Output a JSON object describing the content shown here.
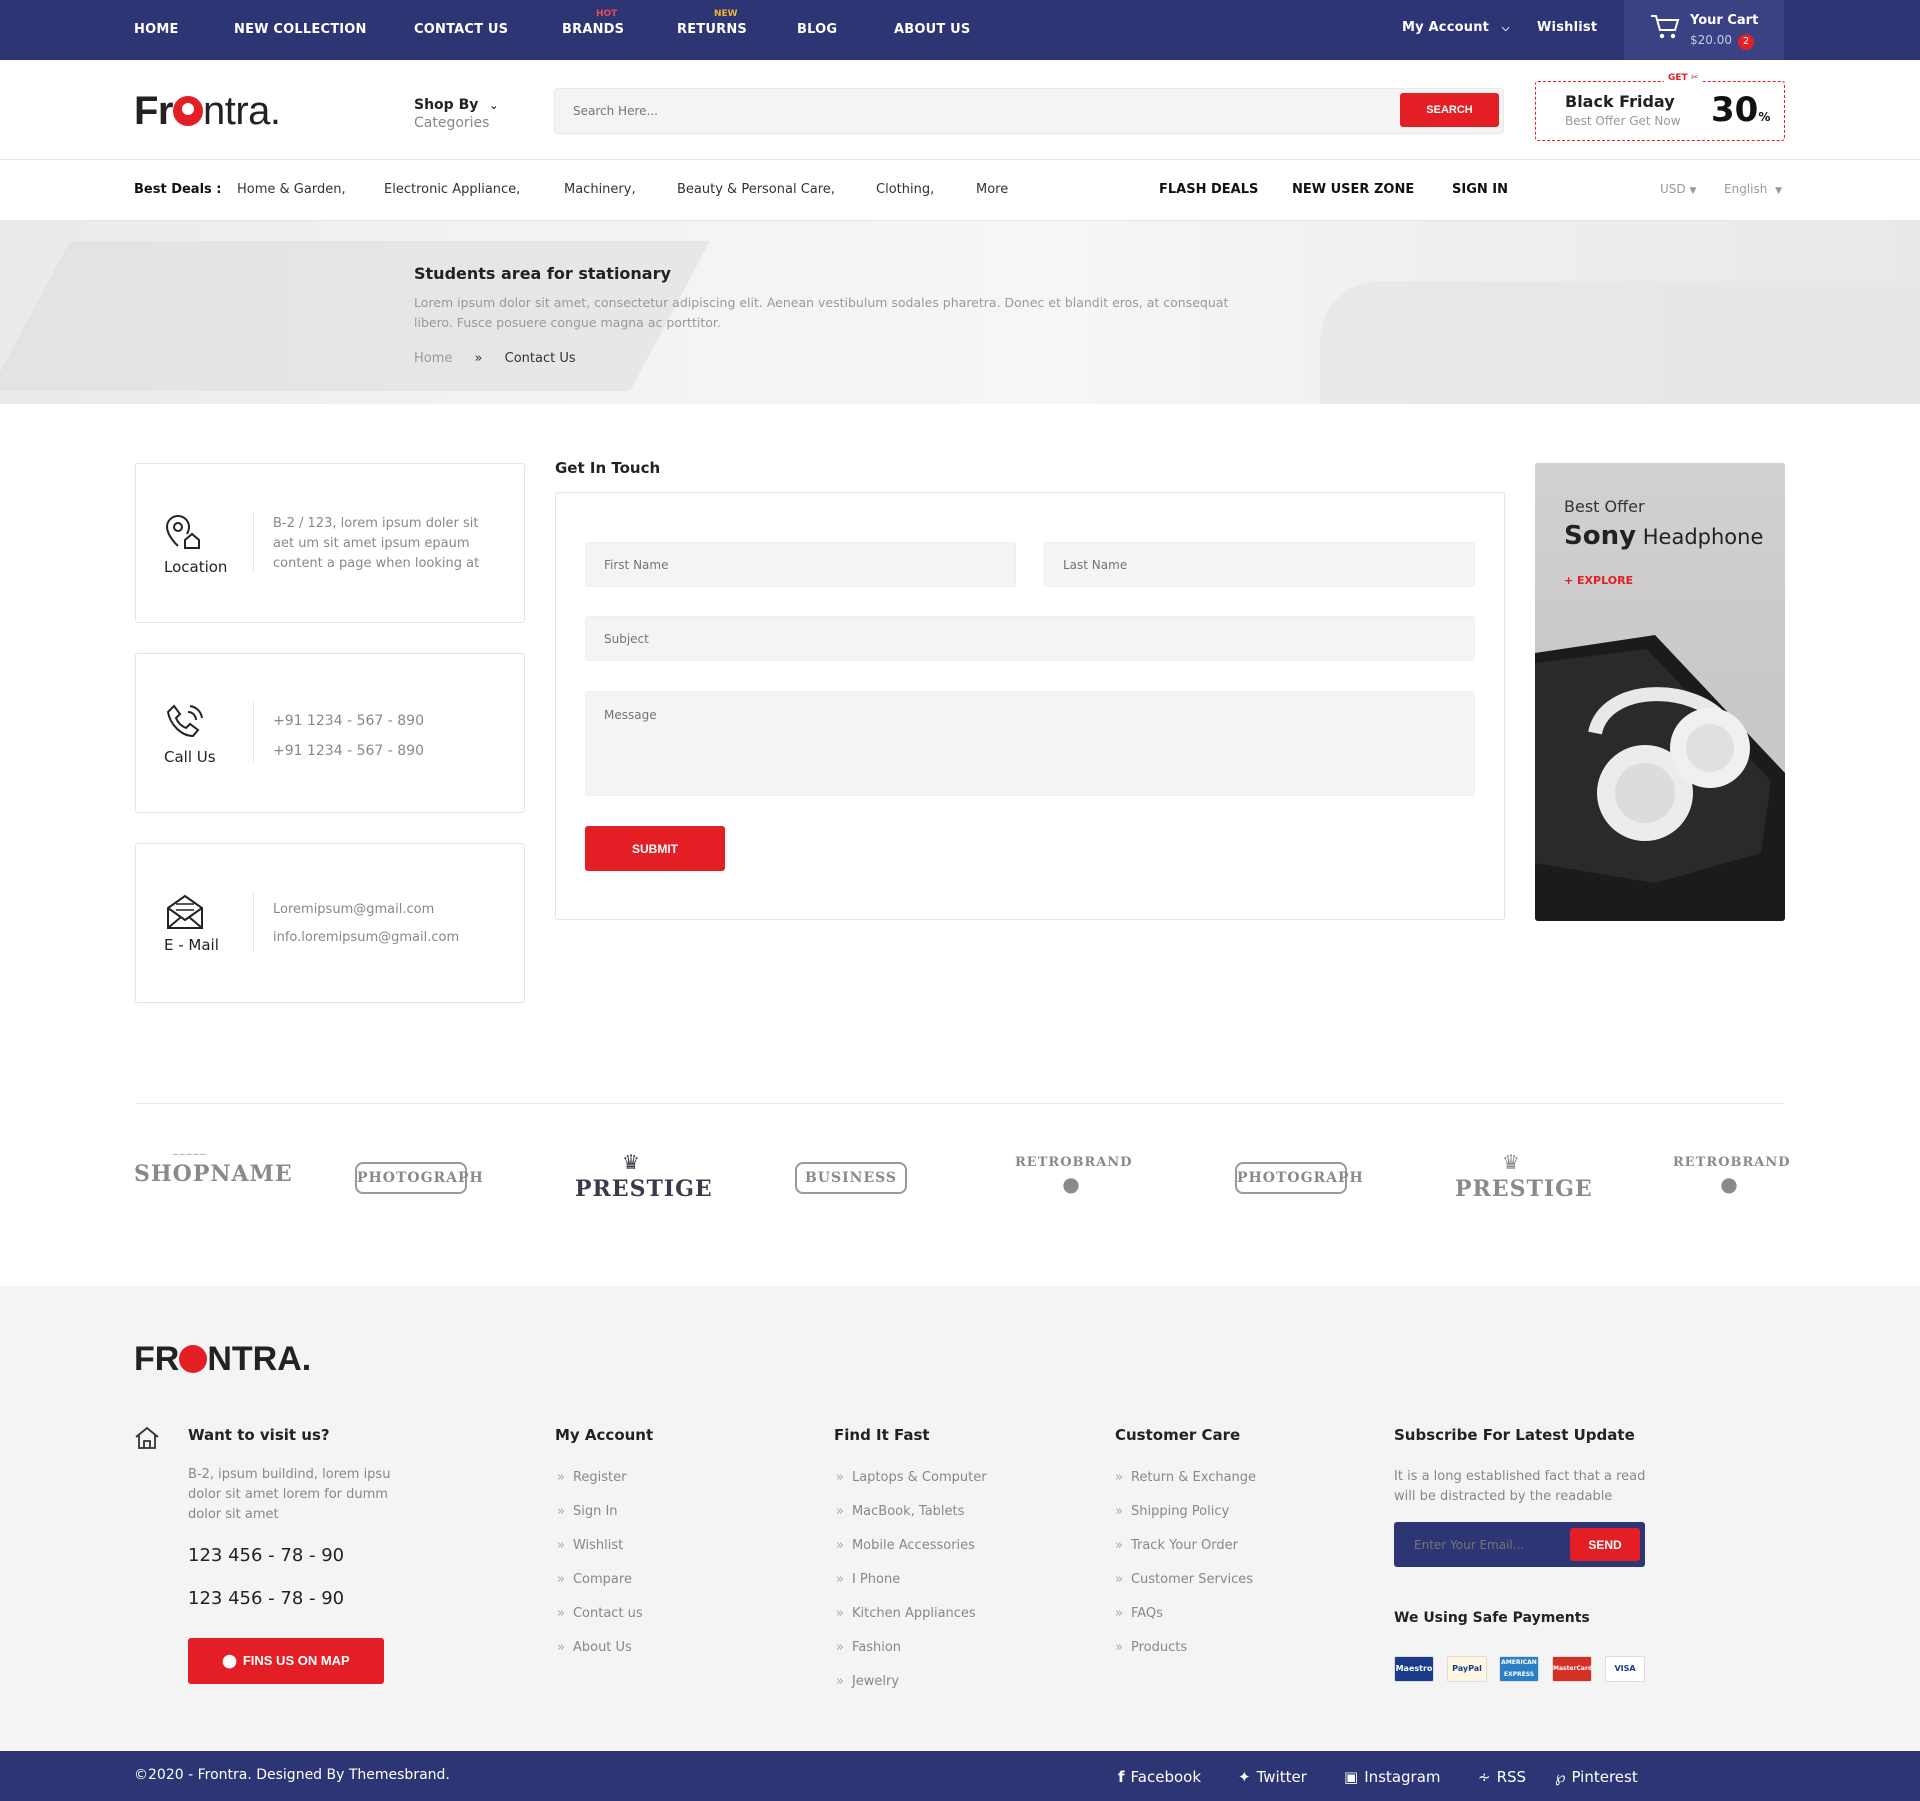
{
  "topnav": {
    "items": [
      "HOME",
      "NEW COLLECTION",
      "CONTACT US",
      "BRANDS",
      "RETURNS",
      "BLOG",
      "ABOUT US"
    ],
    "badge_hot": "HOT",
    "badge_new": "NEW",
    "my_account": "My Account",
    "wishlist": "Wishlist",
    "cart_label": "Your Cart",
    "cart_total": "$20.00",
    "cart_count": "2"
  },
  "header": {
    "logo_a": "Fr",
    "logo_b": "ntra.",
    "shop_by": "Shop By",
    "categories": "Categories",
    "search_placeholder": "Search Here...",
    "search_button": "SEARCH",
    "promo_get": "GET",
    "promo_title": "Black Friday",
    "promo_sub": "Best Offer Get Now",
    "promo_value": "30",
    "promo_unit": "%"
  },
  "deals": {
    "label": "Best Deals :",
    "items": [
      "Home & Garden,",
      "Electronic Appliance,",
      "Machinery,",
      "Beauty & Personal Care,",
      "Clothing,",
      "More"
    ],
    "links": [
      "FLASH DEALS",
      "NEW USER ZONE",
      "SIGN IN"
    ],
    "currency": "USD",
    "language": "English"
  },
  "hero": {
    "title": "Students area for stationary",
    "text": "Lorem ipsum dolor sit amet, consectetur adipiscing elit. Aenean vestibulum sodales pharetra. Donec et blandit eros, at consequat libero. Fusce posuere congue magna ac porttitor.",
    "breadcrumb_home": "Home",
    "breadcrumb_sep": "»",
    "breadcrumb_current": "Contact Us"
  },
  "contact": {
    "location_label": "Location",
    "location_text": "B-2 / 123, lorem ipsum doler sit aet um sit amet ipsum epaum content a page when looking at",
    "call_label": "Call Us",
    "phone1": "+91 1234 - 567 - 890",
    "phone2": "+91 1234 - 567 - 890",
    "mail_label": "E - Mail",
    "email1": "Loremipsum@gmail.com",
    "email2": "info.loremipsum@gmail.com"
  },
  "form": {
    "title": "Get In Touch",
    "first_name": "First Name",
    "last_name": "Last Name",
    "subject": "Subject",
    "message": "Message",
    "submit": "SUBMIT"
  },
  "offer": {
    "kicker": "Best Offer",
    "brand": "Sony",
    "product": "Headphone",
    "cta": "+ EXPLORE"
  },
  "brands": [
    "SHOPNAME",
    "PHOTOGRAPH",
    "PRESTIGE",
    "BUSINESS",
    "RETROBRAND",
    "PHOTOGRAPH",
    "PRESTIGE",
    "RETROBRAND"
  ],
  "footer": {
    "logo_a": "FR",
    "logo_b": "NTRA.",
    "visit_title": "Want to visit us?",
    "visit_text": "B-2, ipsum buildind, lorem ipsu dolor sit amet lorem for dumm dolor sit amet",
    "phone1": "123 456 - 78 - 90",
    "phone2": "123 456 - 78 - 90",
    "map_button": "FINS US ON MAP",
    "col_account_title": "My Account",
    "col_account": [
      "Register",
      "Sign In",
      "Wishlist",
      "Compare",
      "Contact us",
      "About Us"
    ],
    "col_find_title": "Find It Fast",
    "col_find": [
      "Laptops & Computer",
      "MacBook, Tablets",
      "Mobile Accessories",
      "I Phone",
      "Kitchen Appliances",
      "Fashion",
      "Jewelry"
    ],
    "col_care_title": "Customer Care",
    "col_care": [
      "Return & Exchange",
      "Shipping Policy",
      "Track Your Order",
      "Customer Services",
      "FAQs",
      "Products"
    ],
    "subscribe_title": "Subscribe For Latest Update",
    "subscribe_text": "It is a long established fact that a read will be distracted by the readable",
    "email_placeholder": "Enter Your Email...",
    "send": "SEND",
    "payments_title": "We Using Safe Payments",
    "payments": [
      "Maestro",
      "PayPal",
      "AMERICAN EXPRESS",
      "MasterCard",
      "VISA"
    ],
    "copyright": "©2020 - Frontra. Designed By Themesbrand.",
    "social": [
      "Facebook",
      "Twitter",
      "Instagram",
      "RSS",
      "Pinterest"
    ]
  },
  "colors": {
    "primary": "#2e3574",
    "accent": "#e31e24",
    "footer_bg": "#f4f4f4"
  }
}
